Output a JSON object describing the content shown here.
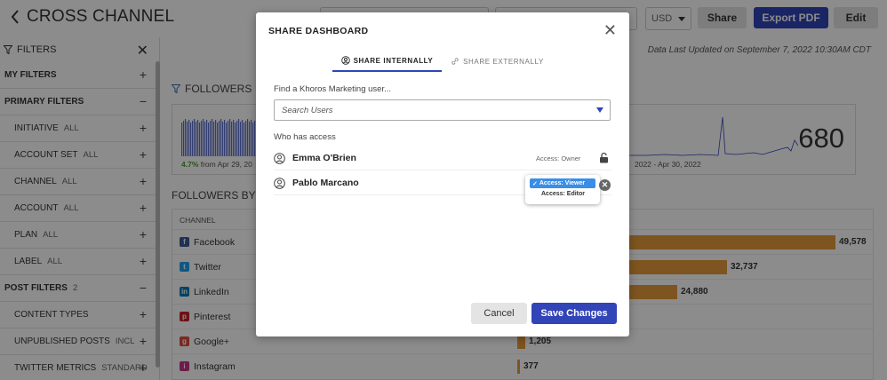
{
  "header": {
    "title": "CROSS CHANNEL",
    "currency": "USD",
    "share_label": "Share",
    "export_label": "Export PDF",
    "edit_label": "Edit"
  },
  "sidebar": {
    "title": "FILTERS",
    "rows": [
      {
        "label": "MY FILTERS",
        "value": "",
        "toggle": "+"
      },
      {
        "label": "PRIMARY FILTERS",
        "value": "",
        "toggle": "−"
      },
      {
        "label": "INITIATIVE",
        "value": "ALL",
        "toggle": "+"
      },
      {
        "label": "ACCOUNT SET",
        "value": "ALL",
        "toggle": "+"
      },
      {
        "label": "CHANNEL",
        "value": "ALL",
        "toggle": "+"
      },
      {
        "label": "ACCOUNT",
        "value": "ALL",
        "toggle": "+"
      },
      {
        "label": "PLAN",
        "value": "ALL",
        "toggle": "+"
      },
      {
        "label": "LABEL",
        "value": "ALL",
        "toggle": "+"
      },
      {
        "label": "POST FILTERS",
        "value": "2",
        "toggle": "−"
      },
      {
        "label": "CONTENT TYPES",
        "value": "",
        "toggle": "+"
      },
      {
        "label": "UNPUBLISHED POSTS",
        "value": "INCL",
        "toggle": "+"
      },
      {
        "label": "TWITTER METRICS",
        "value": "STANDARD",
        "toggle": "+"
      }
    ]
  },
  "main": {
    "updated": "Data Last Updated on September 7, 2022 10:30AM CDT",
    "followers_title": "FOLLOWERS",
    "card_left": {
      "change_pct": "4.7%",
      "change_text": " from Apr 29, 20"
    },
    "card_right": {
      "range": "2022 - Apr 30, 2022",
      "value": "680"
    },
    "by_channel_title": "FOLLOWERS BY CH",
    "table_header": "CHANNEL",
    "channels": [
      {
        "name": "Facebook",
        "value": "49,578",
        "num": 49578,
        "color": "#3b5998",
        "glyph": "f"
      },
      {
        "name": "Twitter",
        "value": "32,737",
        "num": 32737,
        "color": "#1da1f2",
        "glyph": "t"
      },
      {
        "name": "LinkedIn",
        "value": "24,880",
        "num": 24880,
        "color": "#0077b5",
        "glyph": "in"
      },
      {
        "name": "Pinterest",
        "value": "",
        "num": 0,
        "color": "#cb2027",
        "glyph": "p"
      },
      {
        "name": "Google+",
        "value": "1,205",
        "num": 1205,
        "color": "#dd4b39",
        "glyph": "g"
      },
      {
        "name": "Instagram",
        "value": "377",
        "num": 377,
        "color": "#c13584",
        "glyph": "i"
      }
    ]
  },
  "modal": {
    "title": "SHARE DASHBOARD",
    "tab_internal": "SHARE INTERNALLY",
    "tab_external": "SHARE EXTERNALLY",
    "find_label": "Find a Khoros Marketing user...",
    "search_placeholder": "Search Users",
    "who_label": "Who has access",
    "users": [
      {
        "name": "Emma O'Brien",
        "access": "Access: Owner"
      },
      {
        "name": "Pablo Marcano",
        "access": "Access: Viewer"
      }
    ],
    "access_options": [
      "Access: Viewer",
      "Access: Editor"
    ],
    "cancel_label": "Cancel",
    "save_label": "Save Changes"
  }
}
